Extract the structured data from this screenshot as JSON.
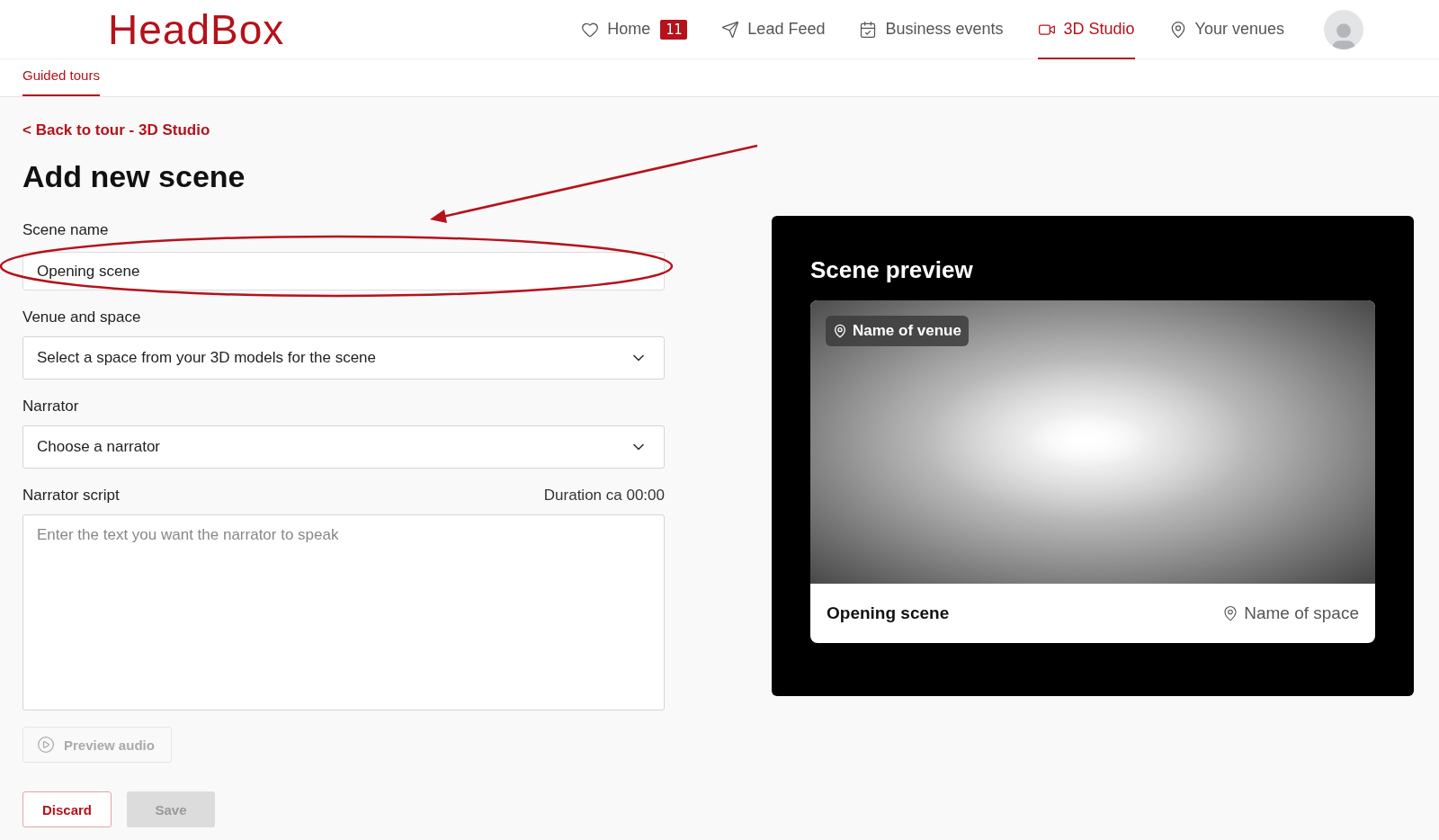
{
  "header": {
    "logo": "HeadBox",
    "nav": [
      {
        "label": "Home",
        "selected": false,
        "badge": "11"
      },
      {
        "label": "Lead Feed",
        "selected": false
      },
      {
        "label": "Business events",
        "selected": false
      },
      {
        "label": "3D Studio",
        "selected": true
      },
      {
        "label": "Your venues",
        "selected": false
      }
    ]
  },
  "subnav": [
    {
      "label": "Guided tours",
      "selected": true
    }
  ],
  "back_link": "< Back to tour - 3D Studio",
  "title": "Add new scene",
  "fields": [
    {
      "kind": "text",
      "label": "Scene name",
      "value": "Opening scene"
    },
    {
      "kind": "select",
      "label": "Venue and space",
      "value": "Select a space from your 3D models for the scene"
    },
    {
      "kind": "select",
      "label": "Narrator",
      "value": "Choose a narrator"
    },
    {
      "kind": "textarea",
      "label": "Narrator script",
      "aside": "Duration ca 00:00",
      "placeholder": "Enter the text you want the narrator to speak"
    }
  ],
  "preview_audio": {
    "label": "Preview audio",
    "disabled": true
  },
  "actions": [
    {
      "label": "Discard",
      "kind": "secondary",
      "disabled": false
    },
    {
      "label": "Save",
      "kind": "primary",
      "disabled": true
    }
  ],
  "preview": {
    "title": "Scene preview",
    "venue": "Name of venue",
    "scene": "Opening scene",
    "space": "Name of space"
  }
}
